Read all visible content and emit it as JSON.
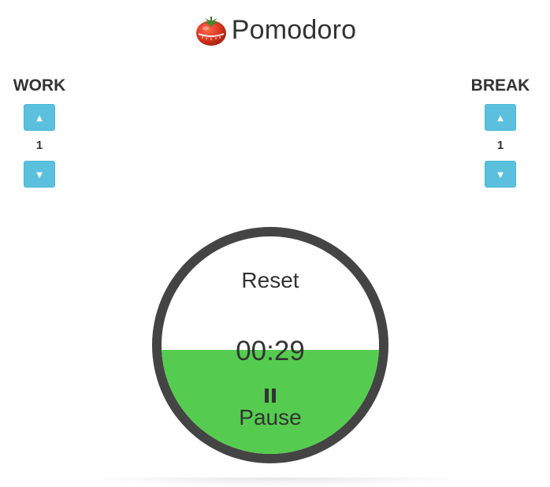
{
  "header": {
    "title": "Pomodoro",
    "icon": "tomato-icon"
  },
  "work": {
    "label": "WORK",
    "value": "1",
    "up_icon": "▲",
    "down_icon": "▼"
  },
  "break": {
    "label": "BREAK",
    "value": "1",
    "up_icon": "▲",
    "down_icon": "▼"
  },
  "timer": {
    "reset_label": "Reset",
    "time": "00:29",
    "pause_label": "Pause",
    "progress_fraction": 0.48
  },
  "colors": {
    "accent_button": "#5bc0de",
    "progress_fill": "#55cc4f",
    "ring": "#444444",
    "text": "#333333"
  }
}
